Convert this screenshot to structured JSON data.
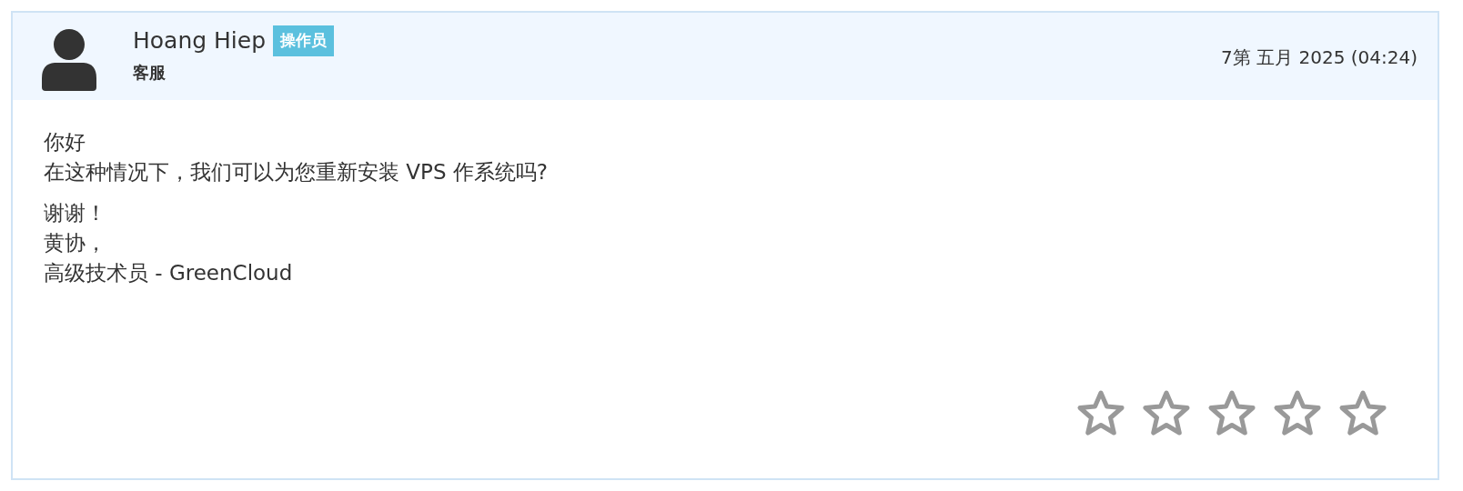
{
  "author": {
    "name": "Hoang Hiep",
    "badge": "操作员",
    "role": "客服"
  },
  "date": "7第 五月 2025 (04:24)",
  "message": {
    "paragraphs": [
      [
        "你好",
        "在这种情况下，我们可以为您重新安装 VPS 作系统吗?"
      ],
      [
        "谢谢！",
        "黄协，",
        "高级技术员 - GreenCloud"
      ]
    ]
  },
  "rating": [
    {
      "filled": false
    },
    {
      "filled": false
    },
    {
      "filled": false
    },
    {
      "filled": false
    },
    {
      "filled": false
    }
  ]
}
